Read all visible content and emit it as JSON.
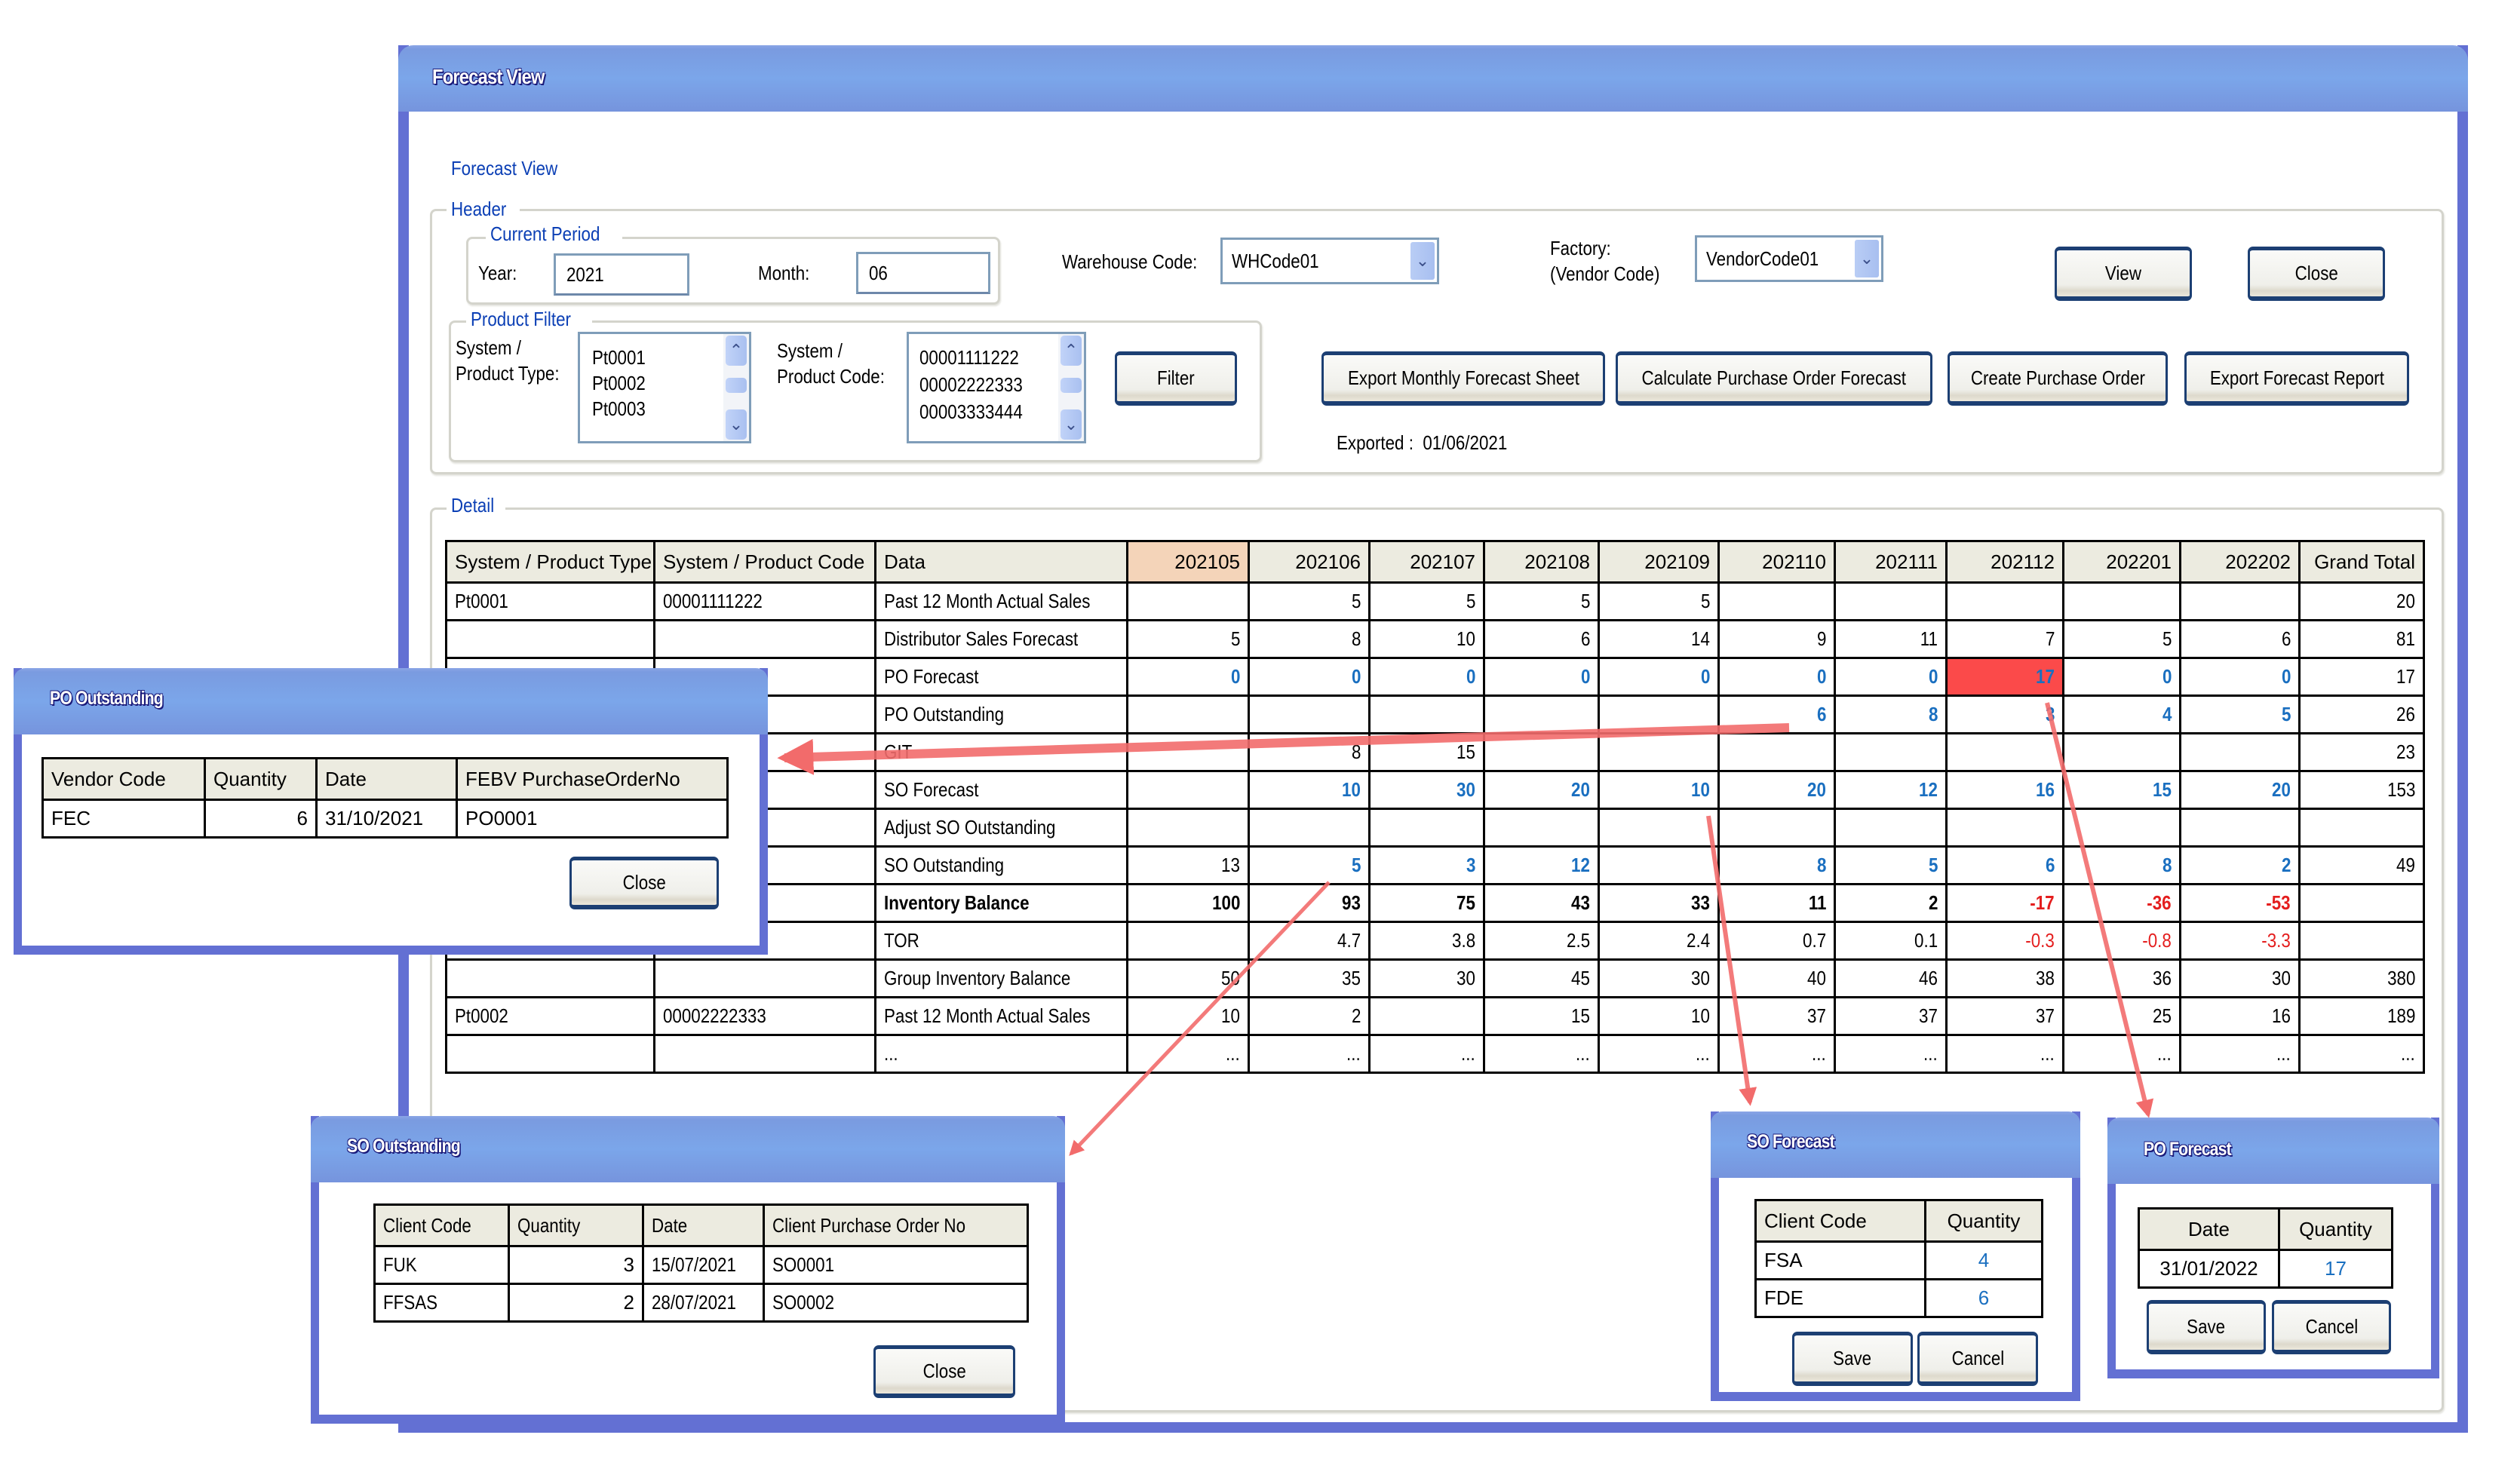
{
  "main_window": {
    "title": "Forecast View",
    "page_title": "Forecast View",
    "header_legend": "Header",
    "current_period": {
      "legend": "Current Period",
      "year_label": "Year:",
      "year_value": "2021",
      "month_label": "Month:",
      "month_value": "06"
    },
    "warehouse": {
      "label": "Warehouse Code:",
      "value": "WHCode01"
    },
    "factory": {
      "label_line1": "Factory:",
      "label_line2": "(Vendor Code)",
      "value": "VendorCode01"
    },
    "view_button": "View",
    "close_button": "Close",
    "product_filter": {
      "legend": "Product Filter",
      "type_label_line1": "System /",
      "type_label_line2": "Product Type:",
      "type_items": [
        "Pt0001",
        "Pt0002",
        "Pt0003"
      ],
      "code_label_line1": "System /",
      "code_label_line2": "Product Code:",
      "code_items": [
        "00001111222",
        "00002222333",
        "00003333444"
      ],
      "filter_button": "Filter"
    },
    "actions": {
      "export_monthly": "Export Monthly Forecast Sheet",
      "calculate_po": "Calculate Purchase Order Forecast",
      "create_po": "Create Purchase Order",
      "export_report": "Export Forecast Report"
    },
    "exported_label": "Exported :",
    "exported_value": "01/06/2021",
    "detail_legend": "Detail"
  },
  "detail_table": {
    "columns": [
      "System / Product Type",
      "System / Product Code",
      "Data",
      "202105",
      "202106",
      "202107",
      "202108",
      "202109",
      "202110",
      "202111",
      "202112",
      "202201",
      "202202",
      "Grand Total"
    ],
    "current_period_column": "202105",
    "rows": [
      {
        "type": "Pt0001",
        "code": "00001111222",
        "data": "Past 12 Month Actual Sales",
        "values": [
          "",
          "5",
          "5",
          "5",
          "5",
          "",
          "",
          "",
          "",
          ""
        ],
        "total": "20"
      },
      {
        "type": "",
        "code": "",
        "data": "Distributor Sales Forecast",
        "values": [
          "5",
          "8",
          "10",
          "6",
          "14",
          "9",
          "11",
          "7",
          "5",
          "6"
        ],
        "total": "81"
      },
      {
        "type": "",
        "code": "",
        "data": "PO Forecast",
        "style": "link",
        "values": [
          "0",
          "0",
          "0",
          "0",
          "0",
          "0",
          "0",
          "17",
          "0",
          "0"
        ],
        "total": "17",
        "highlight_column": "202112"
      },
      {
        "type": "",
        "code": "",
        "data": "PO Outstanding",
        "style": "link",
        "values": [
          "",
          "",
          "",
          "",
          "",
          "6",
          "8",
          "3",
          "4",
          "5"
        ],
        "total": "26"
      },
      {
        "type": "",
        "code": "",
        "data": "GIT",
        "values": [
          "",
          "8",
          "15",
          "",
          "",
          "",
          "",
          "",
          "",
          ""
        ],
        "total": "23"
      },
      {
        "type": "",
        "code": "",
        "data": "SO Forecast",
        "style": "link",
        "values": [
          "",
          "10",
          "30",
          "20",
          "10",
          "20",
          "12",
          "16",
          "15",
          "20"
        ],
        "total": "153"
      },
      {
        "type": "",
        "code": "",
        "data": "Adjust SO Outstanding",
        "values": [
          "",
          "",
          "",
          "",
          "",
          "",
          "",
          "",
          "",
          ""
        ],
        "total": ""
      },
      {
        "type": "",
        "code": "",
        "data": "SO Outstanding",
        "style": "link-after-first",
        "values": [
          "13",
          "5",
          "3",
          "12",
          "",
          "8",
          "5",
          "6",
          "8",
          "2"
        ],
        "total": "49"
      },
      {
        "type": "",
        "code": "",
        "data": "Inventory Balance",
        "style": "bold",
        "values": [
          "100",
          "93",
          "75",
          "43",
          "33",
          "11",
          "2",
          "-17",
          "-36",
          "-53"
        ],
        "total": ""
      },
      {
        "type": "",
        "code": "",
        "data": "TOR",
        "values": [
          "",
          "4.7",
          "3.8",
          "2.5",
          "2.4",
          "0.7",
          "0.1",
          "-0.3",
          "-0.8",
          "-3.3"
        ],
        "total": ""
      },
      {
        "type": "",
        "code": "",
        "data": "Group Inventory Balance",
        "values": [
          "50",
          "35",
          "30",
          "45",
          "30",
          "40",
          "46",
          "38",
          "36",
          "30"
        ],
        "total": "380"
      },
      {
        "type": "Pt0002",
        "code": "00002222333",
        "data": "Past 12 Month Actual Sales",
        "values": [
          "10",
          "2",
          "",
          "15",
          "10",
          "37",
          "37",
          "37",
          "25",
          "16"
        ],
        "total": "189"
      },
      {
        "type": "",
        "code": "",
        "data": "...",
        "values": [
          "...",
          "...",
          "...",
          "...",
          "...",
          "...",
          "...",
          "...",
          "...",
          "..."
        ],
        "total": "..."
      }
    ]
  },
  "po_outstanding_popup": {
    "title": "PO Outstanding",
    "columns": [
      "Vendor Code",
      "Quantity",
      "Date",
      "FEBV PurchaseOrderNo"
    ],
    "rows": [
      [
        "FEC",
        "6",
        "31/10/2021",
        "PO0001"
      ]
    ],
    "close_button": "Close"
  },
  "so_outstanding_popup": {
    "title": "SO Outstanding",
    "columns": [
      "Client Code",
      "Quantity",
      "Date",
      "Client Purchase Order No"
    ],
    "rows": [
      [
        "FUK",
        "3",
        "15/07/2021",
        "SO0001"
      ],
      [
        "FFSAS",
        "2",
        "28/07/2021",
        "SO0002"
      ]
    ],
    "close_button": "Close"
  },
  "so_forecast_popup": {
    "title": "SO Forecast",
    "columns": [
      "Client Code",
      "Quantity"
    ],
    "rows": [
      [
        "FSA",
        "4"
      ],
      [
        "FDE",
        "6"
      ]
    ],
    "save_button": "Save",
    "cancel_button": "Cancel"
  },
  "po_forecast_popup": {
    "title": "PO Forecast",
    "columns": [
      "Date",
      "Quantity"
    ],
    "rows": [
      [
        "31/01/2022",
        "17"
      ]
    ],
    "save_button": "Save",
    "cancel_button": "Cancel"
  },
  "colors": {
    "titlebar": "#7ba6ea",
    "frame": "#6370d3",
    "legend_text": "#0b3fb5",
    "link": "#1a6fc0",
    "negative": "#e41e1e",
    "highlight_cell": "#fb4a4a",
    "current_period_header": "#f4d4b9",
    "table_header": "#ecebe0",
    "annotation_arrow": "#f26b6b"
  }
}
